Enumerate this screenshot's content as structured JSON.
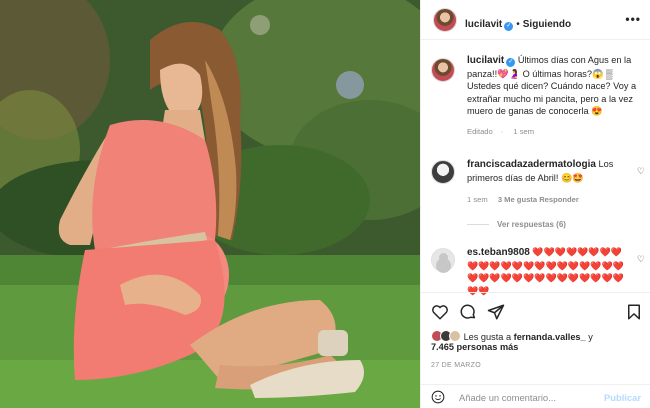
{
  "post": {
    "author": "lucilavit",
    "follow_label": "Siguiendo",
    "more_label": "•••",
    "caption": "Últimos días con Agus en la panza!!💖🤰 O últimas horas?😱 ▒ Ustedes qué dicen? Cuándo nace? Voy a extrañar mucho mi pancita, pero a la vez muero de ganas de conocerla 😍",
    "edited_label": "Editado",
    "caption_time": "1 sem",
    "date": "27 DE MARZO"
  },
  "comments": [
    {
      "user": "franciscadazadermatologia",
      "text": "Los primeros días de Abril! 😊🤩",
      "time": "1 sem",
      "likes_label": "3 Me gusta",
      "reply_label": "Responder",
      "replies_label": "Ver respuestas (6)"
    },
    {
      "user": "es.teban9808",
      "text": "❤️❤️❤️❤️❤️❤️❤️❤️❤️❤️❤️❤️❤️❤️❤️❤️❤️❤️❤️❤️❤️❤️❤️❤️❤️❤️❤️❤️❤️❤️❤️❤️❤️❤️❤️❤️❤️❤️"
    }
  ],
  "likes": {
    "prefix": "Les gusta a",
    "user": "fernanda.valles_",
    "conjunction": "y",
    "count_label": "7.465 personas más"
  },
  "add_comment": {
    "placeholder": "Añade un comentario...",
    "publish_label": "Publicar"
  },
  "colors": {
    "link_blue": "#3897f0",
    "publish_disabled": "#b3dbff",
    "heart_red": "#ed4956",
    "secondary_text": "#8e8e8e"
  },
  "icons": {
    "like": "heart-icon",
    "comment": "comment-icon",
    "share": "send-icon",
    "save": "bookmark-icon",
    "emoji": "emoji-icon",
    "more": "more-icon"
  }
}
